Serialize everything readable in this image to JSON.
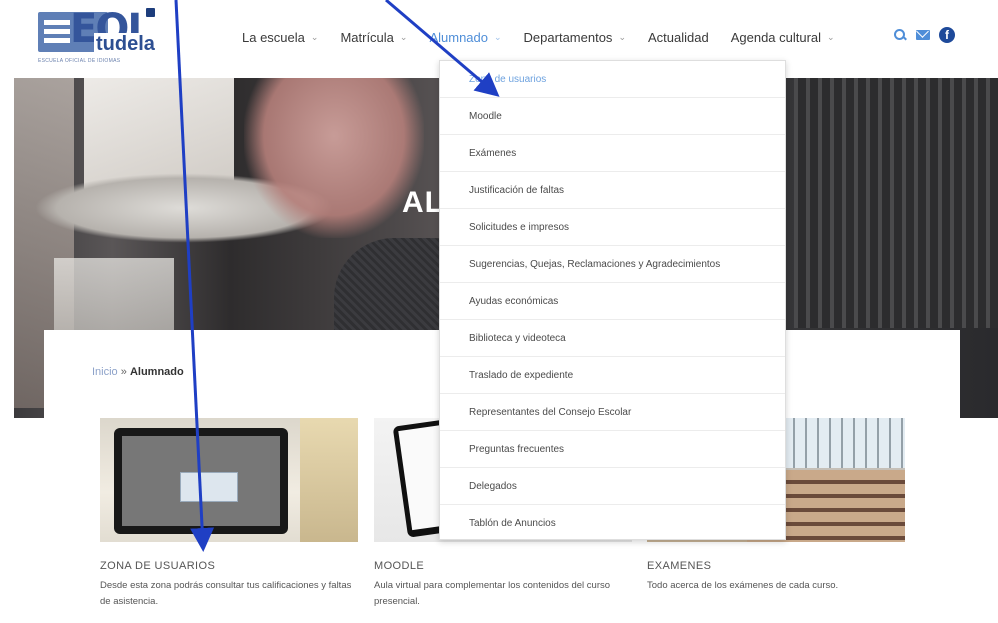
{
  "logo": {
    "letters": "EOI",
    "name": "tudela",
    "subtitle": "ESCUELA OFICIAL DE IDIOMAS"
  },
  "nav": {
    "items": [
      {
        "label": "La escuela",
        "dropdown": true
      },
      {
        "label": "Matrícula",
        "dropdown": true
      },
      {
        "label": "Alumnado",
        "dropdown": true,
        "active": true
      },
      {
        "label": "Departamentos",
        "dropdown": true
      },
      {
        "label": "Actualidad",
        "dropdown": false
      },
      {
        "label": "Agenda cultural",
        "dropdown": true
      }
    ],
    "icons": [
      "search-icon",
      "mail-icon",
      "facebook-icon"
    ],
    "chevron": "⌄",
    "facebook_glyph": "f"
  },
  "hero": {
    "title": "AL"
  },
  "dropdown": {
    "items": [
      "Zona de usuarios",
      "Moodle",
      "Exámenes",
      "Justificación de faltas",
      "Solicitudes e impresos",
      "Sugerencias, Quejas, Reclamaciones y Agradecimientos",
      "Ayudas económicas",
      "Biblioteca y videoteca",
      "Traslado de expediente",
      "Representantes del Consejo Escolar",
      "Preguntas frecuentes",
      "Delegados",
      "Tablón de Anuncios"
    ],
    "active_index": 0
  },
  "breadcrumb": {
    "home": "Inicio",
    "separator": "»",
    "current": "Alumnado"
  },
  "cards": [
    {
      "title": "ZONA DE USUARIOS",
      "description": "Desde esta zona podrás consultar tus calificaciones y faltas de asistencia."
    },
    {
      "title": "MOODLE",
      "description": "Aula virtual para complementar los contenidos del curso presencial."
    },
    {
      "title": "EXAMENES",
      "description": "Todo acerca de los exámenes de cada curso."
    }
  ],
  "colors": {
    "accent": "#4f8ed8",
    "annotation_arrow": "#1f3fc4",
    "brand": "#34559b"
  }
}
